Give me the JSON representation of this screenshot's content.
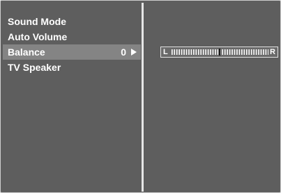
{
  "menu": {
    "items": [
      {
        "label": "Sound Mode",
        "value": ""
      },
      {
        "label": "Auto Volume",
        "value": ""
      },
      {
        "label": "Balance",
        "value": "0"
      },
      {
        "label": "TV Speaker",
        "value": ""
      }
    ],
    "selected_index": 2
  },
  "balance": {
    "left_label": "L",
    "right_label": "R",
    "value": 0,
    "min": -50,
    "max": 50
  },
  "colors": {
    "background": "#5e5e5e",
    "highlight": "#848484",
    "text": "#ffffff"
  }
}
